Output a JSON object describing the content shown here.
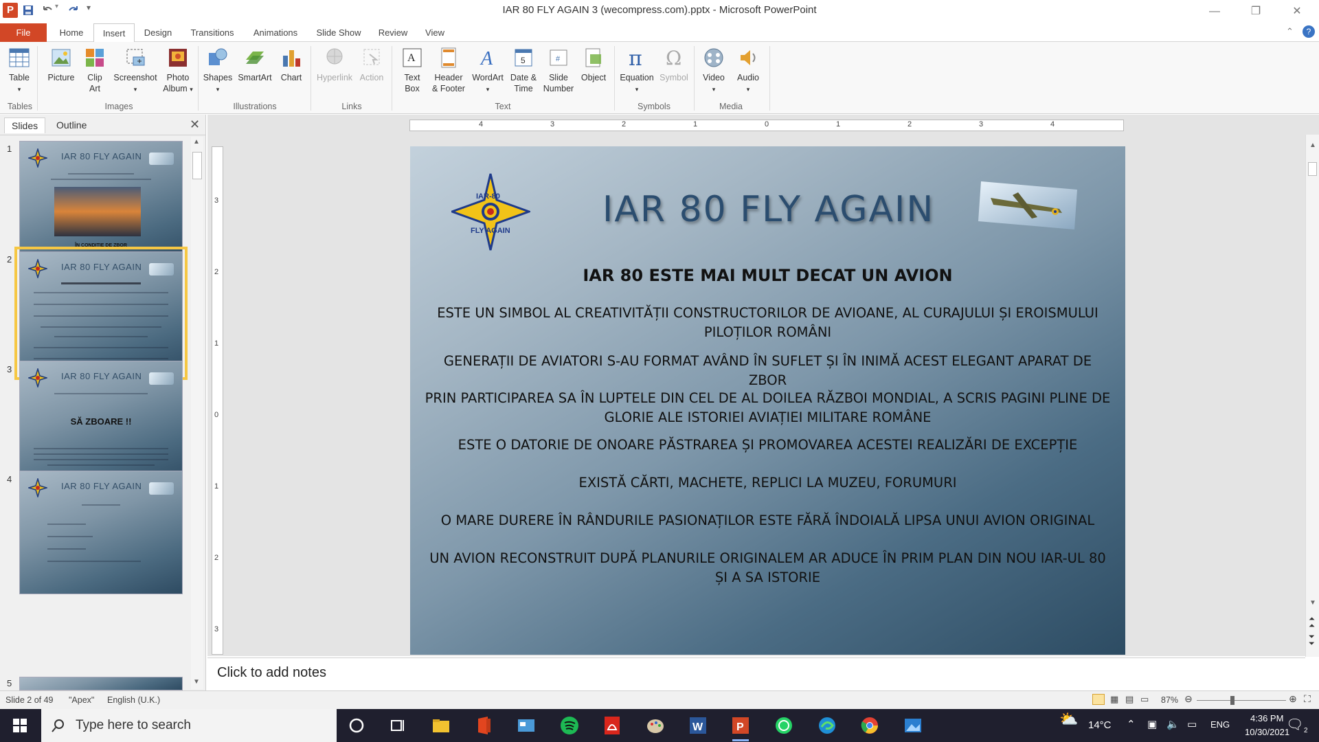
{
  "window": {
    "title": "IAR 80 FLY AGAIN 3 (wecompress.com).pptx  -  Microsoft PowerPoint",
    "app_letter": "P"
  },
  "ribbon_tabs": [
    "File",
    "Home",
    "Insert",
    "Design",
    "Transitions",
    "Animations",
    "Slide Show",
    "Review",
    "View"
  ],
  "active_tab": "Insert",
  "ribbon": {
    "groups": {
      "tables": "Tables",
      "images": "Images",
      "illustrations": "Illustrations",
      "links": "Links",
      "text": "Text",
      "symbols": "Symbols",
      "media": "Media"
    },
    "buttons": {
      "table": "Table",
      "picture": "Picture",
      "clip_art_1": "Clip",
      "clip_art_2": "Art",
      "screenshot": "Screenshot",
      "photo_album_1": "Photo",
      "photo_album_2": "Album",
      "shapes": "Shapes",
      "smartart": "SmartArt",
      "chart": "Chart",
      "hyperlink": "Hyperlink",
      "action": "Action",
      "text_box_1": "Text",
      "text_box_2": "Box",
      "header_footer_1": "Header",
      "header_footer_2": "& Footer",
      "wordart": "WordArt",
      "date_time_1": "Date &",
      "date_time_2": "Time",
      "slide_number_1": "Slide",
      "slide_number_2": "Number",
      "object": "Object",
      "equation": "Equation",
      "symbol": "Symbol",
      "video": "Video",
      "audio": "Audio"
    }
  },
  "left_panel": {
    "tabs": [
      "Slides",
      "Outline"
    ],
    "active_tab": "Slides",
    "thumbnails": [
      {
        "number": "1",
        "title": "IAR 80 FLY AGAIN",
        "big": "ÎN CONDIȚIE DE ZBOR"
      },
      {
        "number": "2",
        "title": "IAR 80 FLY AGAIN",
        "big": ""
      },
      {
        "number": "3",
        "title": "IAR 80 FLY AGAIN",
        "big": "SĂ ZBOARE !!"
      },
      {
        "number": "4",
        "title": "IAR 80 FLY AGAIN",
        "big": ""
      },
      {
        "number": "5",
        "title": "",
        "big": ""
      }
    ],
    "selected_slide": "2"
  },
  "ruler": {
    "h_numbers": [
      "4",
      "3",
      "2",
      "1",
      "0",
      "1",
      "2",
      "3",
      "4"
    ],
    "v_numbers": [
      "3",
      "2",
      "1",
      "0",
      "1",
      "2",
      "3"
    ]
  },
  "slide": {
    "title": "IAR 80 FLY AGAIN",
    "heading": "IAR 80 ESTE MAI MULT DECAT UN AVION",
    "paragraphs": [
      {
        "line1": "ESTE UN SIMBOL AL CREATIVITĂȚII CONSTRUCTORILOR  DE AVIOANE,  AL CURAJULUI ȘI EROISMULUI",
        "line2": "PILOȚILOR ROMÂNI"
      },
      {
        "line1": "GENERAȚII DE AVIATORI  S-AU FORMAT AVÂND ÎN SUFLET ȘI ÎN INIMĂ ACEST ELEGANT APARAT  DE ZBOR",
        "line2": ""
      },
      {
        "line1": "PRIN PARTICIPAREA  SA ÎN LUPTELE DIN CEL DE AL DOILEA RĂZBOI MONDIAL, A SCRIS PAGINI PLINE DE",
        "line2": "GLORIE ALE ISTORIEI AVIAȚIEI MILITARE ROMÂNE"
      },
      {
        "line1": "ESTE O DATORIE DE ONOARE PĂSTRAREA  ȘI PROMOVAREA  ACESTEI REALIZĂRI DE EXCEPȚIE",
        "line2": ""
      },
      {
        "line1": "EXISTĂ CĂRTI, MACHETE, REPLICI LA MUZEU, FORUMURI",
        "line2": ""
      },
      {
        "line1": "O MARE DURERE ÎN RÂNDURILE  PASIONAȚILOR  ESTE FĂRĂ ÎNDOIALĂ LIPSA UNUI AVION ORIGINAL",
        "line2": ""
      },
      {
        "line1": "UN AVION RECONSTRUIT DUPĂ PLANURILE ORIGINALEM  AR ADUCE ÎN PRIM PLAN DIN NOU IAR-UL 80",
        "line2": "ȘI A SA ISTORIE"
      }
    ],
    "logo_text_top": "IAR-80",
    "logo_text_bottom": "FLY AGAIN"
  },
  "notes": {
    "placeholder": "Click to add notes"
  },
  "status": {
    "slide_info": "Slide 2 of 49",
    "theme": "\"Apex\"",
    "language": "English (U.K.)",
    "zoom": "87%",
    "zoom_fraction": 0.4
  },
  "taskbar": {
    "search_placeholder": "Type here to search",
    "weather": "14°C",
    "lang": "ENG",
    "time": "4:36 PM",
    "date": "10/30/2021",
    "notification_count": "2"
  },
  "colors": {
    "file_tab": "#d24726",
    "slide_title": "#2b4d6f",
    "selection": "#f6c744",
    "taskbar": "#1f1f2e"
  }
}
